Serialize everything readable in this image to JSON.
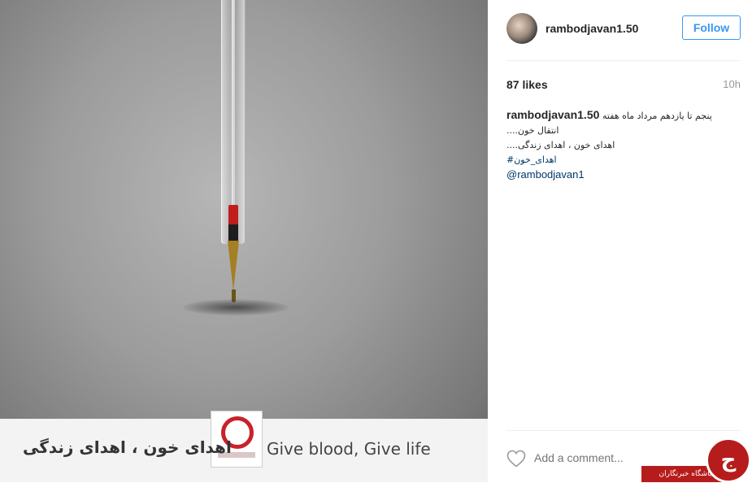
{
  "media": {
    "banner_text_fa": "اهدای خون ، اهدای زندگی",
    "banner_text_en": "Give blood, Give life"
  },
  "header": {
    "username": "rambodjavan1.50",
    "follow_label": "Follow"
  },
  "meta": {
    "likes": "87 likes",
    "time": "10h"
  },
  "caption": {
    "username": "rambodjavan1.50",
    "line1": "پنجم تا یازدهم مرداد ماه هفته",
    "line2": "....انتقال خون",
    "line3": "....اهدای خون ، اهدای زندگی",
    "hashtag": "#اهدای_خون",
    "mention": "@rambodjavan1"
  },
  "comment": {
    "placeholder": "Add a comment..."
  },
  "watermark": {
    "text": "باشگاه خبرنگاران",
    "glyph": "ج"
  },
  "colors": {
    "accent": "#3897f0",
    "link": "#003569",
    "watermark_red": "#b71c1c"
  },
  "icons": [
    "heart-icon",
    "avatar"
  ]
}
